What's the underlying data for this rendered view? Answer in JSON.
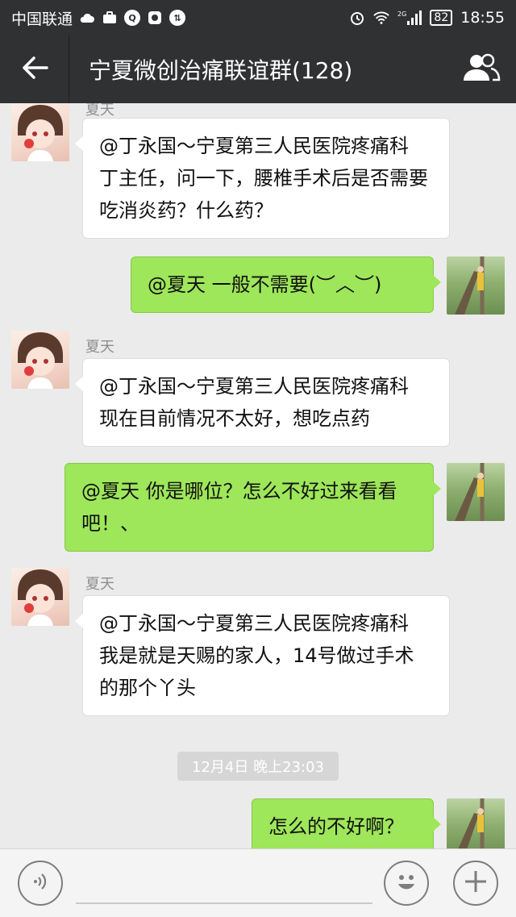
{
  "status_bar": {
    "carrier": "中国联通",
    "signal_label": "2G",
    "battery": "82",
    "time": "18:55"
  },
  "header": {
    "title": "宁夏微创治痛联谊群(128)"
  },
  "messages": [
    {
      "sender": "夏天",
      "direction": "in",
      "text": "@丁永国～宁夏第三人民医院疼痛科 丁主任，问一下，腰椎手术后是否需要吃消炎药？什么药？"
    },
    {
      "direction": "out",
      "text": "@夏天 一般不需要(︶︿︶)"
    },
    {
      "sender": "夏天",
      "direction": "in",
      "text": "@丁永国～宁夏第三人民医院疼痛科 现在目前情况不太好，想吃点药"
    },
    {
      "direction": "out",
      "text": "@夏天 你是哪位？怎么不好过来看看吧！、"
    },
    {
      "sender": "夏天",
      "direction": "in",
      "text": "@丁永国～宁夏第三人民医院疼痛科 我是就是天赐的家人，14号做过手术的那个丫头"
    },
    {
      "direction": "out",
      "text": "怎么的不好啊？"
    }
  ],
  "timestamp": "12月4日 晚上23:03",
  "icons": {
    "back": "back-arrow-icon",
    "group": "group-members-icon",
    "voice": "voice-icon",
    "emoji": "emoji-icon",
    "more": "plus-icon"
  },
  "colors": {
    "header_bg": "#2f3133",
    "chat_bg": "#ebebeb",
    "out_bubble": "#9ee65a",
    "in_bubble": "#ffffff"
  }
}
